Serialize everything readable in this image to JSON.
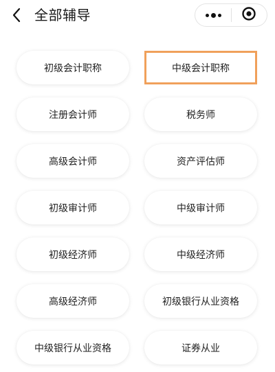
{
  "header": {
    "title": "全部辅导",
    "back_icon": "chevron-left-icon",
    "more_icon": "more-dots-icon",
    "close_icon": "target-circle-icon"
  },
  "accent_color": "#f0a05a",
  "courses": [
    {
      "label": "初级会计职称",
      "selected": false
    },
    {
      "label": "中级会计职称",
      "selected": true
    },
    {
      "label": "注册会计师",
      "selected": false
    },
    {
      "label": "税务师",
      "selected": false
    },
    {
      "label": "高级会计师",
      "selected": false
    },
    {
      "label": "资产评估师",
      "selected": false
    },
    {
      "label": "初级审计师",
      "selected": false
    },
    {
      "label": "中级审计师",
      "selected": false
    },
    {
      "label": "初级经济师",
      "selected": false
    },
    {
      "label": "中级经济师",
      "selected": false
    },
    {
      "label": "高级经济师",
      "selected": false
    },
    {
      "label": "初级银行从业资格",
      "selected": false
    },
    {
      "label": "中级银行从业资格",
      "selected": false
    },
    {
      "label": "证券从业",
      "selected": false
    }
  ]
}
